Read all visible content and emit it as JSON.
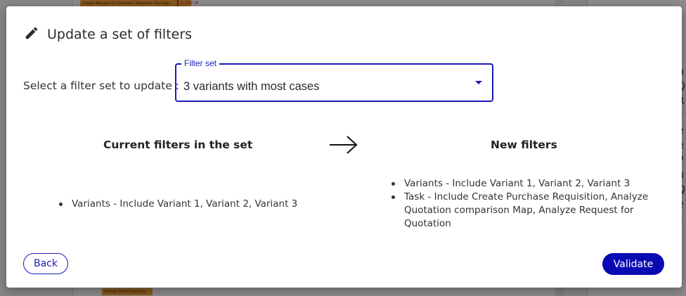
{
  "background": {
    "chip_top": "Create Request for Quotation Requester Manager",
    "chip_bottom": "Deliver Goods Services",
    "red_note": "1 763 /9",
    "right_letters": [
      "u",
      "Q",
      "R",
      "F",
      "e",
      "e",
      "P",
      "u",
      "Q",
      "e",
      "s"
    ]
  },
  "dialog": {
    "title": "Update a set of filters",
    "select_label": "Select a filter set to update :",
    "filter_set": {
      "legend": "Filter set",
      "value": "3 variants with most cases"
    },
    "current": {
      "heading": "Current filters in the set",
      "items": [
        "Variants - Include Variant 1, Variant 2, Variant 3"
      ]
    },
    "new": {
      "heading": "New filters",
      "items": [
        "Variants - Include Variant 1, Variant 2, Variant 3",
        "Task - Include Create Purchase Requisition, Analyze Quotation comparison Map, Analyze Request for Quotation"
      ]
    },
    "back_label": "Back",
    "validate_label": "Validate"
  },
  "colors": {
    "accent": "#1a1ab8",
    "primary_button": "#0a0ab4",
    "overlay": "rgba(0,0,0,0.45)",
    "chip": "#f2a33a"
  }
}
